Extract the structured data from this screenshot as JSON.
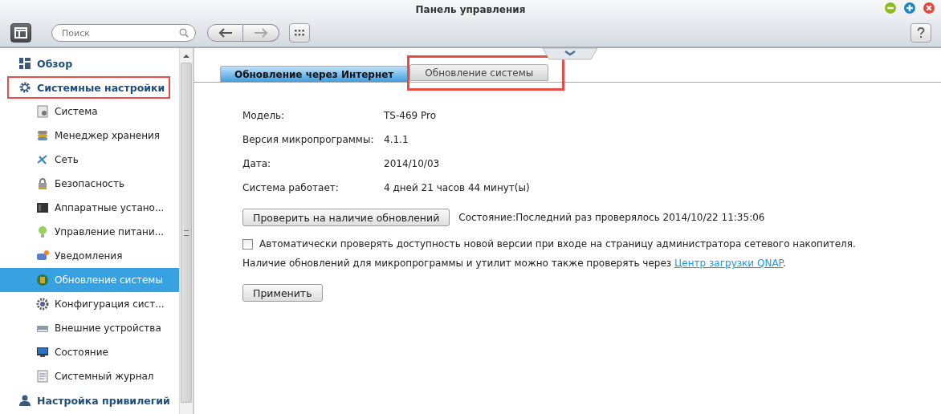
{
  "window": {
    "title": "Панель управления"
  },
  "toolbar": {
    "search": {
      "placeholder": "Поиск"
    }
  },
  "sidebar": {
    "items": [
      {
        "label": "Обзор",
        "selected": false,
        "highlighted": false
      },
      {
        "label": "Системные настройки",
        "selected": false,
        "highlighted": true,
        "children": [
          {
            "label": "Система",
            "selected": false
          },
          {
            "label": "Менеджер хранения",
            "selected": false
          },
          {
            "label": "Сеть",
            "selected": false
          },
          {
            "label": "Безопасность",
            "selected": false
          },
          {
            "label": "Аппаратные устано...",
            "selected": false
          },
          {
            "label": "Управление питани...",
            "selected": false
          },
          {
            "label": "Уведомления",
            "selected": false
          },
          {
            "label": "Обновление системы",
            "selected": true
          },
          {
            "label": "Конфигурация сист...",
            "selected": false
          },
          {
            "label": "Внешние устройства",
            "selected": false
          },
          {
            "label": "Состояние",
            "selected": false
          },
          {
            "label": "Системный журнал",
            "selected": false
          }
        ]
      },
      {
        "label": "Настройка привилегий",
        "selected": false,
        "highlighted": false
      }
    ]
  },
  "tabs": [
    {
      "label": "Обновление через Интернет",
      "selected": true,
      "highlighted": false
    },
    {
      "label": "Обновление системы",
      "selected": false,
      "highlighted": true
    }
  ],
  "info": [
    {
      "label": "Модель:",
      "value": "TS-469 Pro"
    },
    {
      "label": "Версия микропрограммы:",
      "value": "4.1.1"
    },
    {
      "label": "Дата:",
      "value": "2014/10/03"
    },
    {
      "label": "Система работает:",
      "value": "4 дней 21 часов 44 минут(ы)"
    }
  ],
  "check_button": "Проверить на наличие обновлений",
  "status": "Состояние:Последний раз проверялось 2014/10/22 11:35:06",
  "auto_check": {
    "label": "Автоматически проверять доступность новой версии при входе на страницу администратора сетевого накопителя.",
    "checked": false
  },
  "note": {
    "text": "Наличие обновлений для микропрограммы и утилит можно также проверять через ",
    "link": "Центр загрузки QNAP",
    "end": "."
  },
  "apply_button": "Применить"
}
